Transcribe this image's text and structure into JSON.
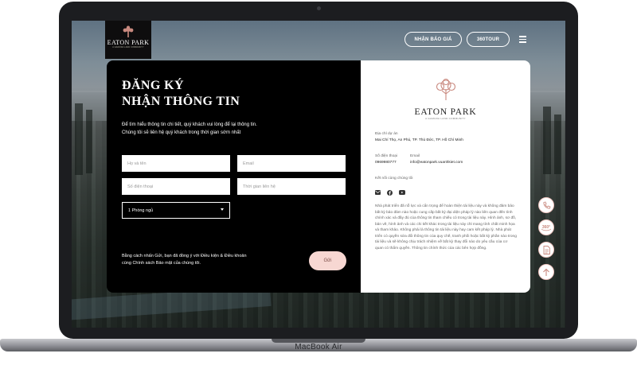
{
  "device": {
    "label": "MacBook Air"
  },
  "nav": {
    "logo_title": "EATON PARK",
    "logo_subtitle": "A GAMUDA LAND COMMUNITY",
    "quote_button": "NHẬN BÁO GIÁ",
    "tour_button": "360TOUR"
  },
  "form": {
    "title_line1": "ĐĂNG KÝ",
    "title_line2": "NHẬN THÔNG TIN",
    "intro_line1": "Để tìm hiểu thông tin chi tiết, quý khách vui lòng để lại thông tin.",
    "intro_line2": "Chúng tôi sẽ liên hệ quý khách trong thời gian sớm nhất",
    "name_placeholder": "Họ và tên",
    "email_placeholder": "Email",
    "phone_placeholder": "Số điện thoại",
    "time_placeholder": "Thời gian liên hệ",
    "room_selected": "1 Phòng ngủ",
    "consent_line1": "Bằng cách nhấn Gửi, bạn đã đồng ý với Điều kiện & Điều khoản",
    "consent_line2": "cùng Chính sách Bảo mật của chúng tôi.",
    "submit": "Gửi"
  },
  "contact": {
    "logo_title": "EATON PARK",
    "logo_subtitle": "A GAMUDA LAND COMMUNITY",
    "address_label": "Địa chỉ dự án",
    "address_value": "Mai Chí Thọ, An Phú, TP. Thủ Đức, TP. Hồ Chí Minh",
    "phone_label": "Số điện thoại",
    "phone_value": "0969980777",
    "email_label": "Email",
    "email_value": "info@eatonpark.vuanhkiet.com",
    "connect_label": "Kết nối cùng chúng tôi",
    "disclaimer": "Nhà phát triển đã nỗ lực và cẩn trọng để hoàn thiện tài liệu này và không đảm bảo bất kỳ bảo đảm nào hoặc cung cấp bất kỳ đại diện pháp lý nào liên quan đến tính chính xác và đầy đủ của thông tin tham chiếu có trong tài liệu này. Hình ảnh, sơ đồ, bản vẽ, hình ảnh và các chi tiết khác trong tài liệu này chỉ mang tính chất minh họa và tham khảo. Không phải là thông tin tài liệu này hay cam kết pháp lý. Nhà phát triển có quyền sửa đổi thông tin của quy chế, tranh phối hoặc bất kỳ phần nào trong tài liệu và sẽ không chịu trách nhiệm về bất kỳ thay đổi nào do yêu cầu của cơ quan có thẩm quyền. Thông tin chính thức của các bên hợp đồng."
  },
  "colors": {
    "accent": "#f7d7d2",
    "brand_pink": "#c9897f",
    "panel": "#000000"
  },
  "floating_icons": [
    "phone-icon",
    "360-icon",
    "document-icon",
    "arrow-up-icon"
  ]
}
